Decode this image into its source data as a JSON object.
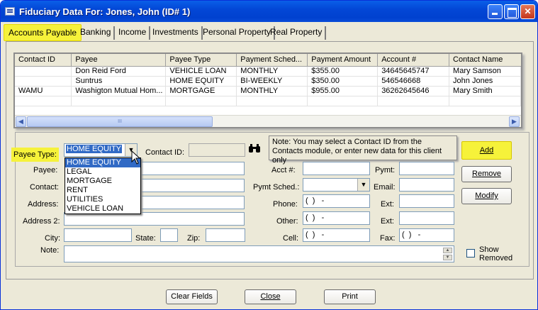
{
  "window": {
    "title": "Fiduciary Data For: Jones, John (ID# 1)"
  },
  "tabs": [
    {
      "label": "Accounts Payable"
    },
    {
      "label": "Banking"
    },
    {
      "label": "Income"
    },
    {
      "label": "Investments"
    },
    {
      "label": "Personal Property"
    },
    {
      "label": "Real Property"
    }
  ],
  "grid": {
    "columns": [
      "Contact ID",
      "Payee",
      "Payee Type",
      "Payment Sched...",
      "Payment Amount",
      "Account #",
      "Contact Name"
    ],
    "rows": [
      [
        "",
        "Don Reid Ford",
        "VEHICLE LOAN",
        "MONTHLY",
        "$355.00",
        "34645645747",
        "Mary Samson"
      ],
      [
        "",
        "Suntrus",
        "HOME EQUITY",
        "BI-WEEKLY",
        "$350.00",
        "546546668",
        "John Jones"
      ],
      [
        "WAMU",
        "Washigton Mutual Hom...",
        "MORTGAGE",
        "MONTHLY",
        "$955.00",
        "36262645646",
        "Mary Smith"
      ]
    ],
    "scroll_thumb_marks": "III"
  },
  "form": {
    "payee_type_label": "Payee Type:",
    "payee_type_value": "HOME EQUITY",
    "payee_type_options": [
      "HOME EQUITY",
      "LEGAL",
      "MORTGAGE",
      "RENT",
      "UTILITIES",
      "VEHICLE LOAN"
    ],
    "contact_id_label": "Contact ID:",
    "payee_label": "Payee:",
    "contact_label": "Contact:",
    "address_label": "Address:",
    "address2_label": "Address 2:",
    "city_label": "City:",
    "state_label": "State:",
    "zip_label": "Zip:",
    "note_label": "Note:",
    "acct_label": "Acct #:",
    "pymt_sched_label": "Pymt Sched.:",
    "phone_label": "Phone:",
    "other_label": "Other:",
    "cell_label": "Cell:",
    "pymt_label": "Pymt:",
    "email_label": "Email:",
    "ext_label": "Ext:",
    "ext2_label": "Ext:",
    "fax_label": "Fax:",
    "phone_mask": "(  )   -",
    "note_text": "Note: You may select a Contact ID from the Contacts module, or enter new data for this client only",
    "show_removed_label_1": "Show",
    "show_removed_label_2": "Removed"
  },
  "buttons": {
    "add": "Add",
    "remove": "Remove",
    "modify": "Modify",
    "clear_fields": "Clear Fields",
    "close": "Close",
    "print": "Print"
  },
  "colors": {
    "highlight": "#f6f23a",
    "titlebar": "#0347d6",
    "selection": "#316ac5"
  }
}
